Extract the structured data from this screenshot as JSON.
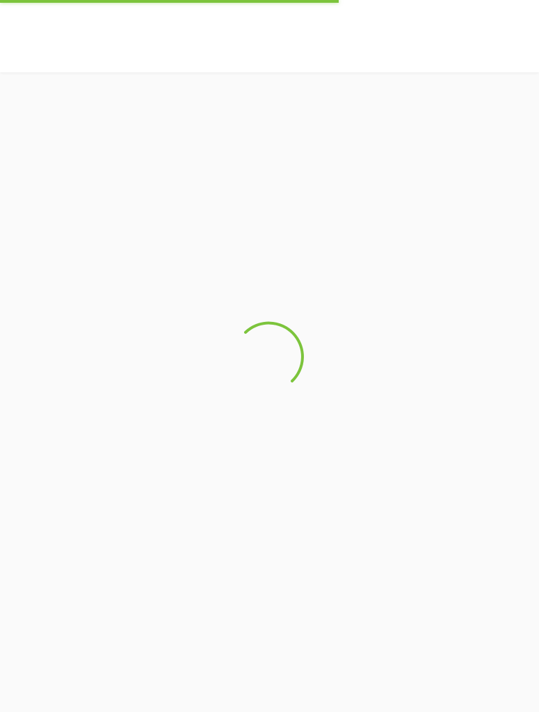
{
  "top_progress": {
    "progress": 0.628,
    "color": "#7cc43c"
  },
  "header": {
    "background": "#ffffff"
  },
  "main": {
    "background": "#fafafa"
  },
  "spinner": {
    "icon": "loading-spinner-icon",
    "color": "#7cc43c"
  }
}
